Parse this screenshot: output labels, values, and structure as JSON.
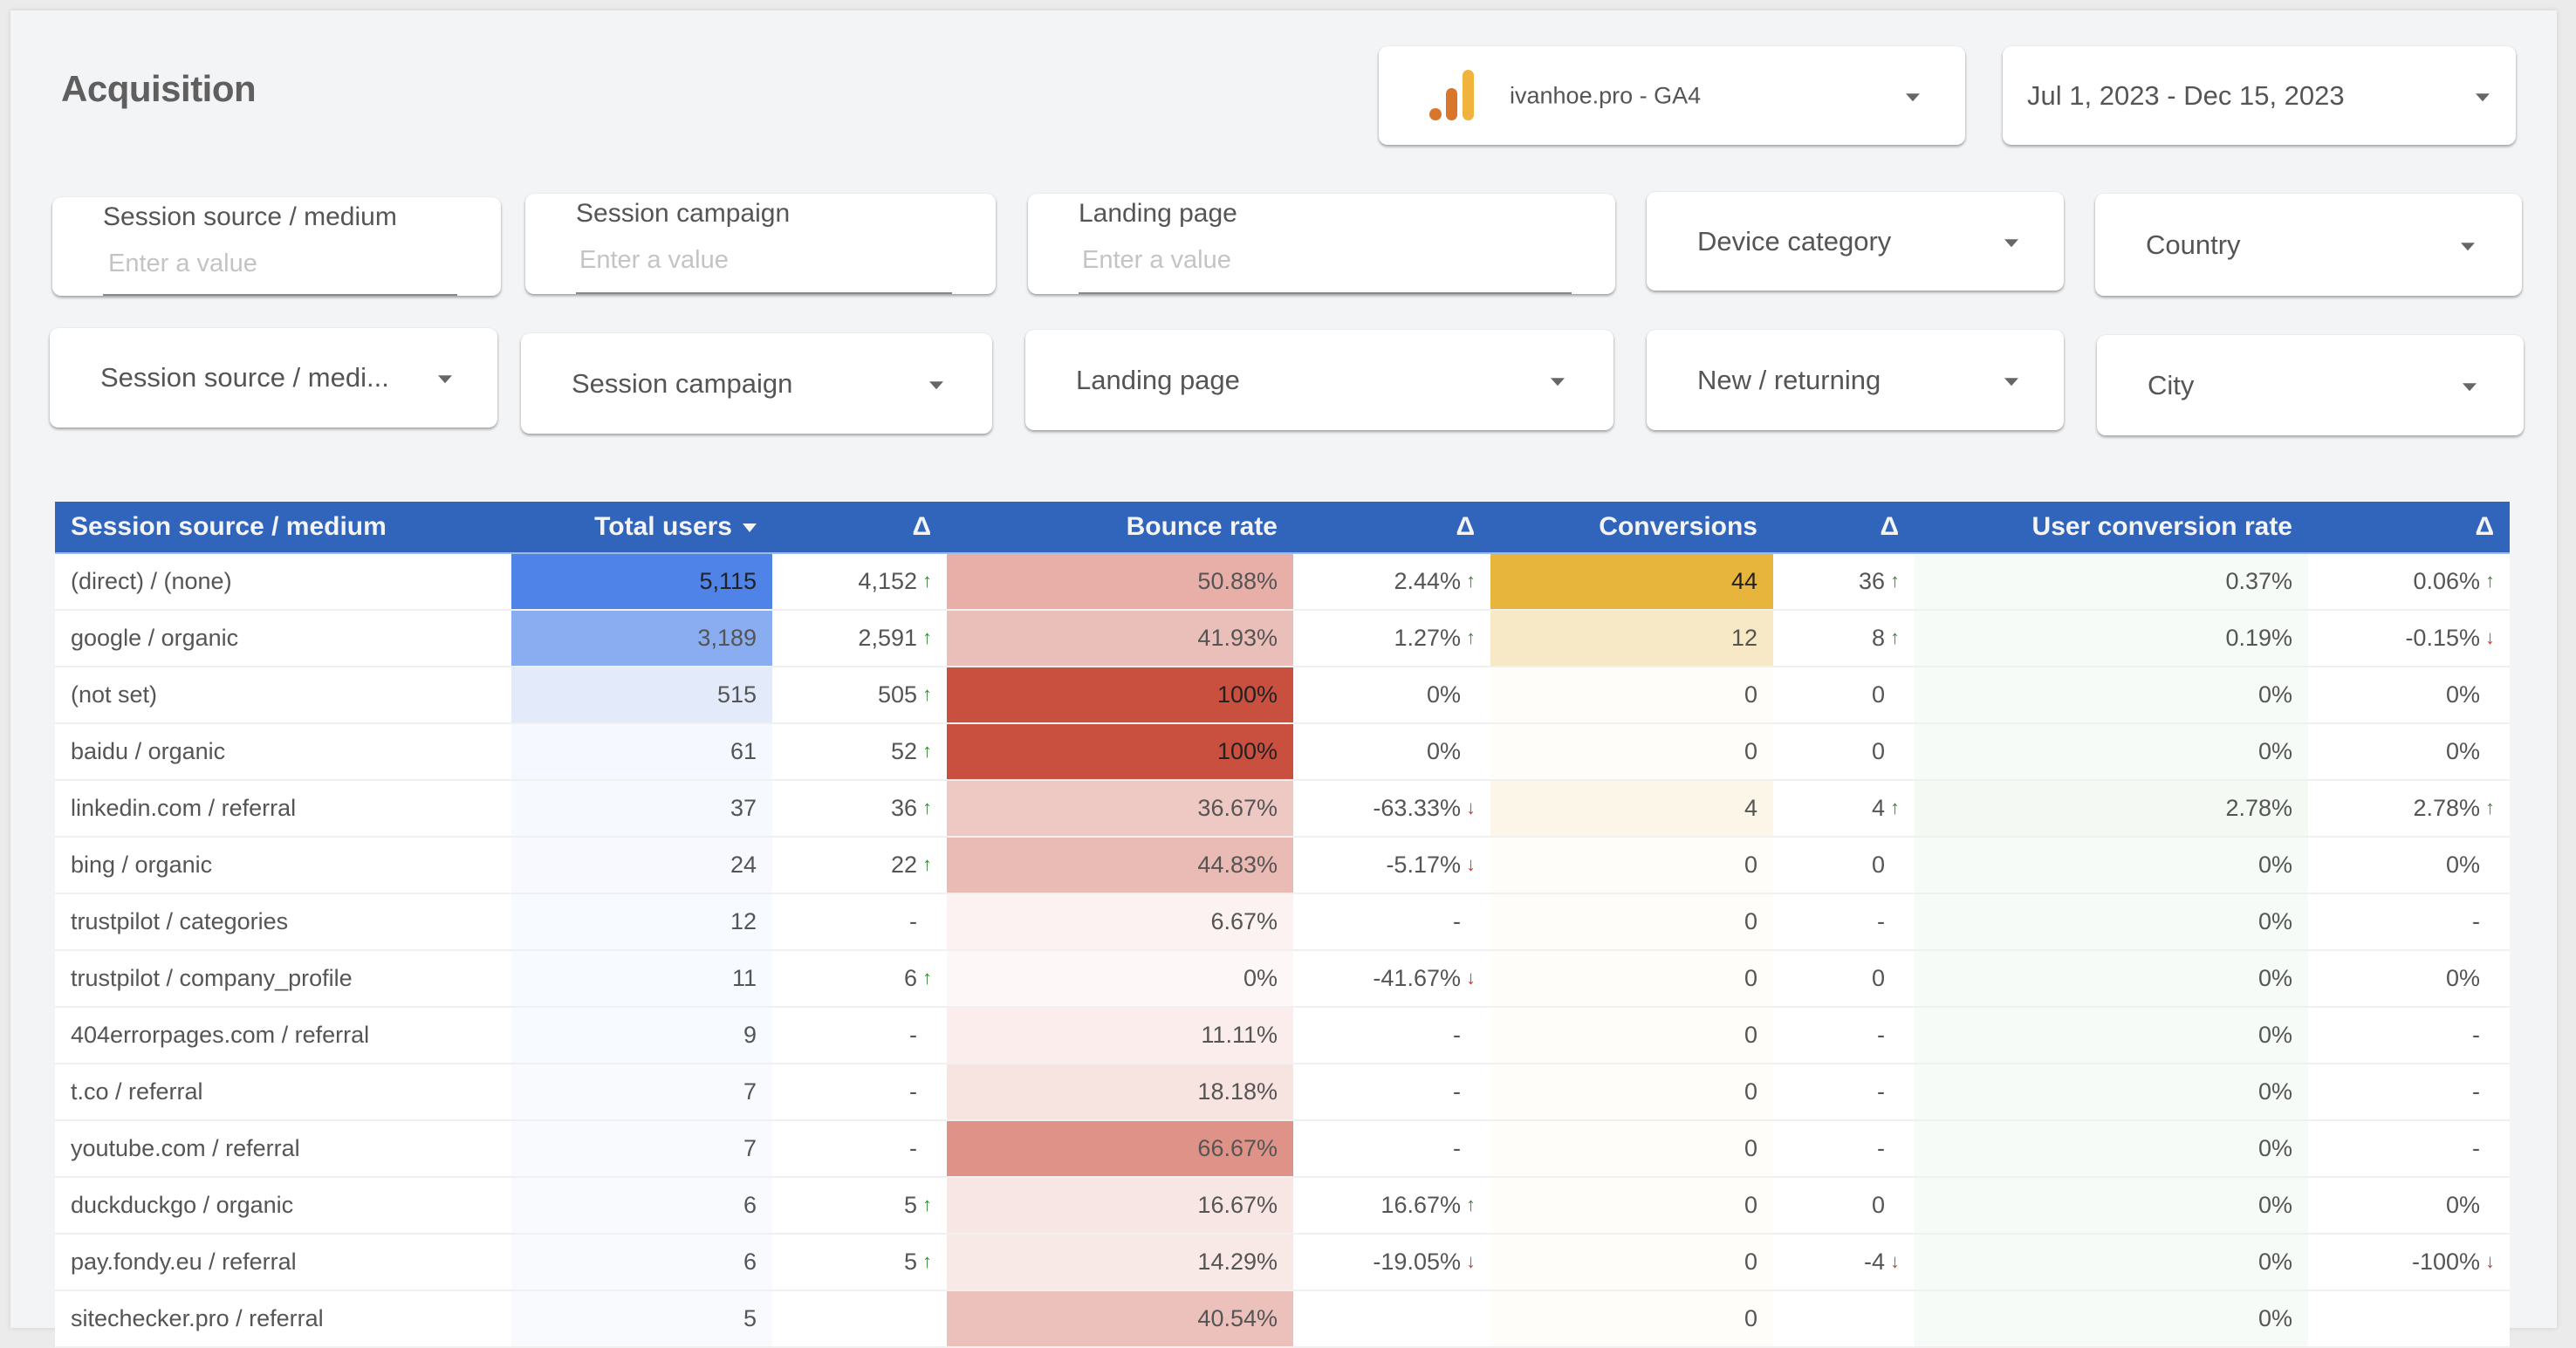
{
  "page": {
    "title": "Acquisition"
  },
  "header": {
    "property_selector": {
      "label": "ivanhoe.pro - GA4",
      "icon": "google-analytics-icon"
    },
    "date_range": {
      "label": "Jul 1, 2023 - Dec 15, 2023"
    }
  },
  "filters": {
    "inputs": [
      {
        "label": "Session source / medium",
        "placeholder": "Enter a value",
        "value": ""
      },
      {
        "label": "Session campaign",
        "placeholder": "Enter a value",
        "value": ""
      },
      {
        "label": "Landing page",
        "placeholder": "Enter a value",
        "value": ""
      }
    ],
    "dropdowns_row1": [
      {
        "label": "Device category"
      },
      {
        "label": "Country"
      }
    ],
    "dropdowns_row2": [
      {
        "label": "Session source / medi..."
      },
      {
        "label": "Session campaign"
      },
      {
        "label": "Landing page"
      },
      {
        "label": "New / returning"
      },
      {
        "label": "City"
      }
    ]
  },
  "colors": {
    "header_bg": "#3165bc",
    "users_heat": "#5083e8",
    "bounce_heat": "#c94f3f",
    "conversions_heat": "#e8b53c",
    "ucr_heat": "#e9f3e9",
    "delta_up": "#3a8a3a",
    "delta_down": "#d63b30"
  },
  "table": {
    "columns": [
      "Session source / medium",
      "Total users",
      "Δ",
      "Bounce rate",
      "Δ",
      "Conversions",
      "Δ",
      "User conversion rate",
      "Δ"
    ],
    "sorted_column": "Total users",
    "sort_direction": "descending",
    "rows": [
      {
        "source": "(direct) / (none)",
        "users": "5,115",
        "users_d": "4,152",
        "users_dir": "up",
        "bounce": "50.88%",
        "bounce_d": "2.44%",
        "bounce_dir": "up",
        "conv": "44",
        "conv_d": "36",
        "conv_dir": "up",
        "ucr": "0.37%",
        "ucr_d": "0.06%",
        "ucr_dir": "up"
      },
      {
        "source": "google / organic",
        "users": "3,189",
        "users_d": "2,591",
        "users_dir": "up",
        "bounce": "41.93%",
        "bounce_d": "1.27%",
        "bounce_dir": "up",
        "conv": "12",
        "conv_d": "8",
        "conv_dir": "up",
        "ucr": "0.19%",
        "ucr_d": "-0.15%",
        "ucr_dir": "down"
      },
      {
        "source": "(not set)",
        "users": "515",
        "users_d": "505",
        "users_dir": "up",
        "bounce": "100%",
        "bounce_d": "0%",
        "bounce_dir": "",
        "conv": "0",
        "conv_d": "0",
        "conv_dir": "",
        "ucr": "0%",
        "ucr_d": "0%",
        "ucr_dir": ""
      },
      {
        "source": "baidu / organic",
        "users": "61",
        "users_d": "52",
        "users_dir": "up",
        "bounce": "100%",
        "bounce_d": "0%",
        "bounce_dir": "",
        "conv": "0",
        "conv_d": "0",
        "conv_dir": "",
        "ucr": "0%",
        "ucr_d": "0%",
        "ucr_dir": ""
      },
      {
        "source": "linkedin.com / referral",
        "users": "37",
        "users_d": "36",
        "users_dir": "up",
        "bounce": "36.67%",
        "bounce_d": "-63.33%",
        "bounce_dir": "down",
        "conv": "4",
        "conv_d": "4",
        "conv_dir": "up",
        "ucr": "2.78%",
        "ucr_d": "2.78%",
        "ucr_dir": "up"
      },
      {
        "source": "bing / organic",
        "users": "24",
        "users_d": "22",
        "users_dir": "up",
        "bounce": "44.83%",
        "bounce_d": "-5.17%",
        "bounce_dir": "down",
        "conv": "0",
        "conv_d": "0",
        "conv_dir": "",
        "ucr": "0%",
        "ucr_d": "0%",
        "ucr_dir": ""
      },
      {
        "source": "trustpilot / categories",
        "users": "12",
        "users_d": "-",
        "users_dir": "",
        "bounce": "6.67%",
        "bounce_d": "-",
        "bounce_dir": "",
        "conv": "0",
        "conv_d": "-",
        "conv_dir": "",
        "ucr": "0%",
        "ucr_d": "-",
        "ucr_dir": ""
      },
      {
        "source": "trustpilot / company_profile",
        "users": "11",
        "users_d": "6",
        "users_dir": "up",
        "bounce": "0%",
        "bounce_d": "-41.67%",
        "bounce_dir": "down",
        "conv": "0",
        "conv_d": "0",
        "conv_dir": "",
        "ucr": "0%",
        "ucr_d": "0%",
        "ucr_dir": ""
      },
      {
        "source": "404errorpages.com / referral",
        "users": "9",
        "users_d": "-",
        "users_dir": "",
        "bounce": "11.11%",
        "bounce_d": "-",
        "bounce_dir": "",
        "conv": "0",
        "conv_d": "-",
        "conv_dir": "",
        "ucr": "0%",
        "ucr_d": "-",
        "ucr_dir": ""
      },
      {
        "source": "t.co / referral",
        "users": "7",
        "users_d": "-",
        "users_dir": "",
        "bounce": "18.18%",
        "bounce_d": "-",
        "bounce_dir": "",
        "conv": "0",
        "conv_d": "-",
        "conv_dir": "",
        "ucr": "0%",
        "ucr_d": "-",
        "ucr_dir": ""
      },
      {
        "source": "youtube.com / referral",
        "users": "7",
        "users_d": "-",
        "users_dir": "",
        "bounce": "66.67%",
        "bounce_d": "-",
        "bounce_dir": "",
        "conv": "0",
        "conv_d": "-",
        "conv_dir": "",
        "ucr": "0%",
        "ucr_d": "-",
        "ucr_dir": ""
      },
      {
        "source": "duckduckgo / organic",
        "users": "6",
        "users_d": "5",
        "users_dir": "up",
        "bounce": "16.67%",
        "bounce_d": "16.67%",
        "bounce_dir": "up",
        "conv": "0",
        "conv_d": "0",
        "conv_dir": "",
        "ucr": "0%",
        "ucr_d": "0%",
        "ucr_dir": ""
      },
      {
        "source": "pay.fondy.eu / referral",
        "users": "6",
        "users_d": "5",
        "users_dir": "up",
        "bounce": "14.29%",
        "bounce_d": "-19.05%",
        "bounce_dir": "down",
        "conv": "0",
        "conv_d": "-4",
        "conv_dir": "down",
        "ucr": "0%",
        "ucr_d": "-100%",
        "ucr_dir": "down"
      },
      {
        "source": "sitechecker.pro / referral",
        "users": "5",
        "users_d": "",
        "users_dir": "",
        "bounce": "40.54%",
        "bounce_d": "",
        "bounce_dir": "",
        "conv": "0",
        "conv_d": "",
        "conv_dir": "",
        "ucr": "0%",
        "ucr_d": "",
        "ucr_dir": ""
      }
    ]
  }
}
